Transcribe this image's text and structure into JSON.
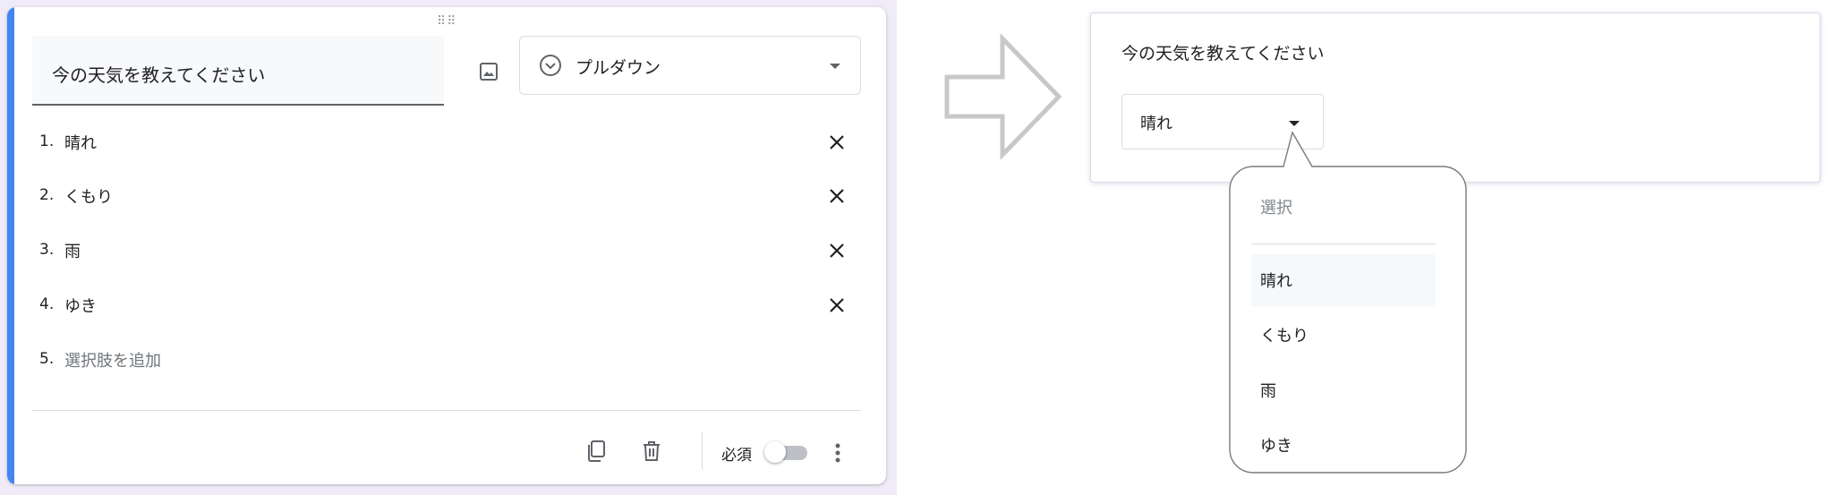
{
  "editor": {
    "question_title": "今の天気を教えてください",
    "question_type": "プルダウン",
    "options": [
      {
        "number": "1.",
        "label": "晴れ"
      },
      {
        "number": "2.",
        "label": "くもり"
      },
      {
        "number": "3.",
        "label": "雨"
      },
      {
        "number": "4.",
        "label": "ゆき"
      }
    ],
    "add_option": {
      "number": "5.",
      "label": "選択肢を追加"
    },
    "required_label": "必須",
    "required_on": false
  },
  "preview": {
    "question_title": "今の天気を教えてください",
    "selected_value": "晴れ",
    "dropdown": {
      "placeholder": "選択",
      "items": [
        "晴れ",
        "くもり",
        "雨",
        "ゆき"
      ],
      "highlighted_item": "晴れ"
    }
  },
  "colors": {
    "accent": "#4285f4",
    "form_background": "#f0ebf8",
    "text": "#202124",
    "secondary_text": "#70757a"
  }
}
